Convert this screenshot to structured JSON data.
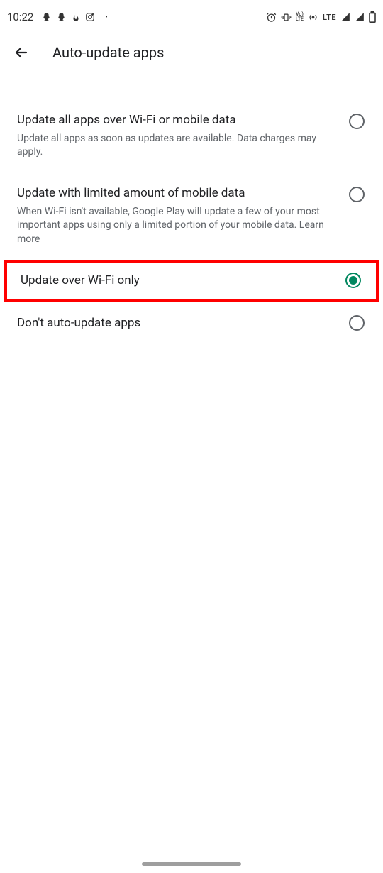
{
  "status_bar": {
    "time": "10:22",
    "lte": "LTE",
    "volte_top": "Vo)",
    "volte_bottom": "LTE"
  },
  "header": {
    "title": "Auto-update apps"
  },
  "options": [
    {
      "title": "Update all apps over Wi-Fi or mobile data",
      "subtitle": "Update all apps as soon as updates are available. Data charges may apply.",
      "selected": false,
      "highlighted": false
    },
    {
      "title": "Update with limited amount of mobile data",
      "subtitle_before": "When Wi-Fi isn't available, Google Play will update a few of your most important apps using only a limited portion of your mobile data. ",
      "link_text": "Learn more",
      "selected": false,
      "highlighted": false
    },
    {
      "title": "Update over Wi-Fi only",
      "selected": true,
      "highlighted": true
    },
    {
      "title": "Don't auto-update apps",
      "selected": false,
      "highlighted": false
    }
  ]
}
